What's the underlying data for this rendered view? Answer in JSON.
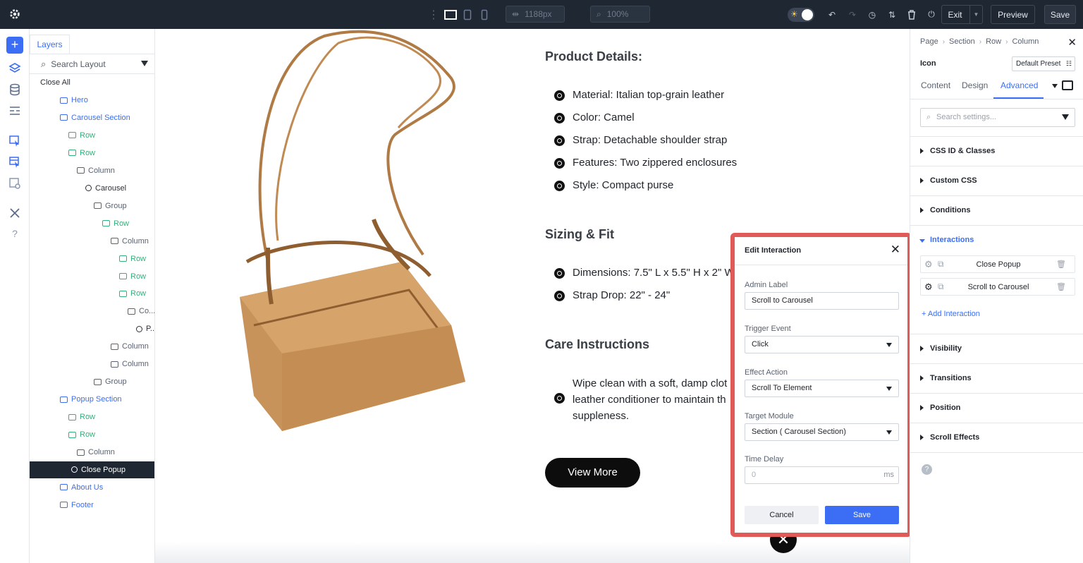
{
  "topbar": {
    "width_label": "1188px",
    "zoom_label": "100%",
    "exit_label": "Exit",
    "preview_label": "Preview",
    "save_label": "Save"
  },
  "layers": {
    "tab_label": "Layers",
    "search_placeholder": "Search Layout",
    "close_all": "Close All",
    "items": [
      {
        "label": "Hero",
        "type": "section"
      },
      {
        "label": "Carousel Section",
        "type": "section"
      },
      {
        "label": "Row",
        "type": "row"
      },
      {
        "label": "Row",
        "type": "row"
      },
      {
        "label": "Column",
        "type": "column"
      },
      {
        "label": "Carousel",
        "type": "module"
      },
      {
        "label": "Group",
        "type": "column"
      },
      {
        "label": "Row",
        "type": "row"
      },
      {
        "label": "Column",
        "type": "column"
      },
      {
        "label": "Row",
        "type": "row"
      },
      {
        "label": "Row",
        "type": "row"
      },
      {
        "label": "Row",
        "type": "row"
      },
      {
        "label": "Co...",
        "type": "column"
      },
      {
        "label": "P...",
        "type": "module"
      },
      {
        "label": "Column",
        "type": "column"
      },
      {
        "label": "Column",
        "type": "column"
      },
      {
        "label": "Group",
        "type": "column"
      },
      {
        "label": "Popup Section",
        "type": "section"
      },
      {
        "label": "Row",
        "type": "row"
      },
      {
        "label": "Row",
        "type": "row"
      },
      {
        "label": "Column",
        "type": "column"
      },
      {
        "label": "Close Popup",
        "type": "module",
        "selected": true
      },
      {
        "label": "About Us",
        "type": "section"
      },
      {
        "label": "Footer",
        "type": "section"
      }
    ]
  },
  "canvas": {
    "product_details_heading": "Product Details:",
    "product_bullets": [
      "Material: Italian top-grain leather",
      "Color: Camel",
      "Strap: Detachable shoulder strap",
      "Features: Two zippered enclosures",
      "Style: Compact purse"
    ],
    "sizing_heading": "Sizing & Fit",
    "sizing_bullets": [
      "Dimensions: 7.5\" L x 5.5\" H x 2\" W",
      "Strap Drop: 22\" - 24\""
    ],
    "care_heading": "Care Instructions",
    "care_lines": [
      "Wipe clean with a soft, damp clot",
      "leather conditioner to maintain th",
      "suppleness."
    ],
    "view_more": "View More"
  },
  "modal": {
    "title": "Edit Interaction",
    "admin_label": "Admin Label",
    "admin_value": "Scroll to Carousel",
    "trigger_label": "Trigger Event",
    "trigger_value": "Click",
    "effect_label": "Effect Action",
    "effect_value": "Scroll To Element",
    "target_label": "Target Module",
    "target_value": "Section ( Carousel Section)",
    "delay_label": "Time Delay",
    "delay_placeholder": "0",
    "delay_unit": "ms",
    "cancel": "Cancel",
    "save": "Save"
  },
  "settings": {
    "breadcrumbs": [
      "Page",
      "Section",
      "Row",
      "Column"
    ],
    "module_title": "Icon",
    "preset": "Default Preset",
    "tabs": [
      "Content",
      "Design",
      "Advanced"
    ],
    "active_tab": "Advanced",
    "search_placeholder": "Search settings...",
    "sections": [
      "CSS ID & Classes",
      "Custom CSS",
      "Conditions",
      "Interactions",
      "Visibility",
      "Transitions",
      "Position",
      "Scroll Effects"
    ],
    "interactions": [
      "Close Popup",
      "Scroll to Carousel"
    ],
    "add_interaction": "+ Add Interaction"
  },
  "colors": {
    "accent": "#3b6ef5",
    "topbar": "#1f2733",
    "highlight_border": "#e05a57",
    "row_green": "#30b27c"
  }
}
